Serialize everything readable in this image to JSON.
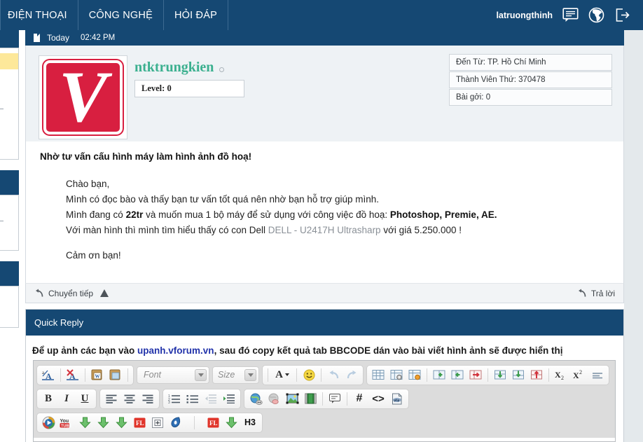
{
  "topnav": {
    "items": [
      {
        "label": "ĐIỆN THOẠI",
        "name": "nav-dien-thoai"
      },
      {
        "label": "CÔNG NGHỆ",
        "name": "nav-cong-nghe"
      },
      {
        "label": "HỎI ĐÁP",
        "name": "nav-hoi-dap"
      }
    ],
    "username": "latruongthinh",
    "icons": [
      "messages-icon",
      "globe-icon",
      "logout-icon"
    ],
    "bg_color": "#154873"
  },
  "post": {
    "date_label": "Today",
    "time_label": "02:42 PM",
    "author": "ntktrungkien",
    "author_color": "#3bb08f",
    "level": "Level: 0",
    "avatar_letter": "V",
    "avatar_color": "#d81f40",
    "info": [
      "Đến Từ: TP. Hồ Chí Minh",
      "Thành Viên Thứ: 370478",
      "Bài gởi: 0"
    ],
    "title": "Nhờ tư vấn cấu hình máy làm hình ảnh đồ hoạ!",
    "body": {
      "line1": "Chào bạn,",
      "line2": "Mình có đọc bào và thấy bạn tư vấn tốt quá nên nhờ bạn hỗ trợ giúp mình.",
      "line3_a": "Mình đang có ",
      "line3_b": "22tr",
      "line3_c": " và muốn mua 1 bộ máy để sử dụng với công việc đồ hoạ: ",
      "line3_d": "Photoshop, Premie, AE.",
      "line4_a": "Với màn hình thì mình tìm hiểu thấy có con Dell ",
      "line4_link": "DELL - U2417H Ultrasharp",
      "line4_b": " với giá 5.250.000 !",
      "line5": "Cảm ơn bạn!"
    },
    "footer": {
      "forward": "Chuyển tiếp",
      "report_icon": "report-warning-icon",
      "reply": "Trả lời"
    }
  },
  "quick_reply": {
    "header": "Quick Reply",
    "note_a": "Để up ảnh các bạn vào ",
    "note_link": "upanh.vforum.vn",
    "note_b": ", sau đó copy kết quả tab BBCODE dán vào bài viết hình ảnh sẽ được hiển thị",
    "link_color": "#2233aa"
  },
  "editor": {
    "font_placeholder": "Font",
    "size_placeholder": "Size",
    "row1": [
      {
        "name": "source-toggle-icon",
        "glyph": "A"
      },
      {
        "name": "remove-format-icon",
        "glyph": "A"
      },
      {
        "name": "paste-from-word-icon",
        "glyph": "W"
      },
      {
        "name": "paste-icon",
        "glyph": "P"
      },
      {
        "name": "text-color-icon",
        "glyph": "A"
      },
      {
        "name": "smiley-icon",
        "glyph": "☺"
      },
      {
        "name": "undo-icon",
        "glyph": "↶"
      },
      {
        "name": "redo-icon",
        "glyph": "↷"
      },
      {
        "name": "insert-table-icon",
        "glyph": "▦"
      },
      {
        "name": "table-properties-icon",
        "glyph": "▦"
      },
      {
        "name": "delete-table-icon",
        "glyph": "▦"
      },
      {
        "name": "insert-column-before-icon",
        "glyph": "▤"
      },
      {
        "name": "insert-column-after-icon",
        "glyph": "▤"
      },
      {
        "name": "delete-column-icon",
        "glyph": "▤"
      },
      {
        "name": "insert-row-before-icon",
        "glyph": "▤"
      },
      {
        "name": "insert-row-after-icon",
        "glyph": "▤"
      },
      {
        "name": "delete-row-icon",
        "glyph": "▤"
      },
      {
        "name": "subscript-icon",
        "glyph": "X₂"
      },
      {
        "name": "superscript-icon",
        "glyph": "X²"
      },
      {
        "name": "horizontal-rule-icon",
        "glyph": "≡"
      }
    ],
    "row2": [
      {
        "name": "bold-icon",
        "glyph": "B"
      },
      {
        "name": "italic-icon",
        "glyph": "I"
      },
      {
        "name": "underline-icon",
        "glyph": "U"
      },
      {
        "name": "align-left-icon",
        "glyph": "≡"
      },
      {
        "name": "align-center-icon",
        "glyph": "≡"
      },
      {
        "name": "align-right-icon",
        "glyph": "≡"
      },
      {
        "name": "numbered-list-icon",
        "glyph": "≔"
      },
      {
        "name": "bulleted-list-icon",
        "glyph": "≔"
      },
      {
        "name": "outdent-icon",
        "glyph": "⇤"
      },
      {
        "name": "indent-icon",
        "glyph": "⇥"
      },
      {
        "name": "insert-link-icon",
        "glyph": "🌐"
      },
      {
        "name": "unlink-icon",
        "glyph": "🌐"
      },
      {
        "name": "insert-image-icon",
        "glyph": "🖼"
      },
      {
        "name": "insert-video-icon",
        "glyph": "🎞"
      },
      {
        "name": "quote-icon",
        "glyph": "❝"
      },
      {
        "name": "code-hash-icon",
        "glyph": "#"
      },
      {
        "name": "source-code-icon",
        "glyph": "<>"
      },
      {
        "name": "php-page-icon",
        "glyph": "▤"
      }
    ],
    "row3": [
      {
        "name": "media-player-icon",
        "glyph": "▶"
      },
      {
        "name": "youtube-icon",
        "glyph": "You"
      },
      {
        "name": "download-arrow-1-icon",
        "glyph": "↓"
      },
      {
        "name": "download-arrow-2-icon",
        "glyph": "↓"
      },
      {
        "name": "download-arrow-3-icon",
        "glyph": "↓"
      },
      {
        "name": "fl-red-1-icon",
        "glyph": "FL"
      },
      {
        "name": "add-box-icon",
        "glyph": "⊞"
      },
      {
        "name": "blue-oval-icon",
        "glyph": "0"
      },
      {
        "name": "fl-red-2-icon",
        "glyph": "FL"
      },
      {
        "name": "download-arrow-4-icon",
        "glyph": "↓"
      },
      {
        "name": "heading-h3-label",
        "glyph": "H3"
      }
    ]
  }
}
